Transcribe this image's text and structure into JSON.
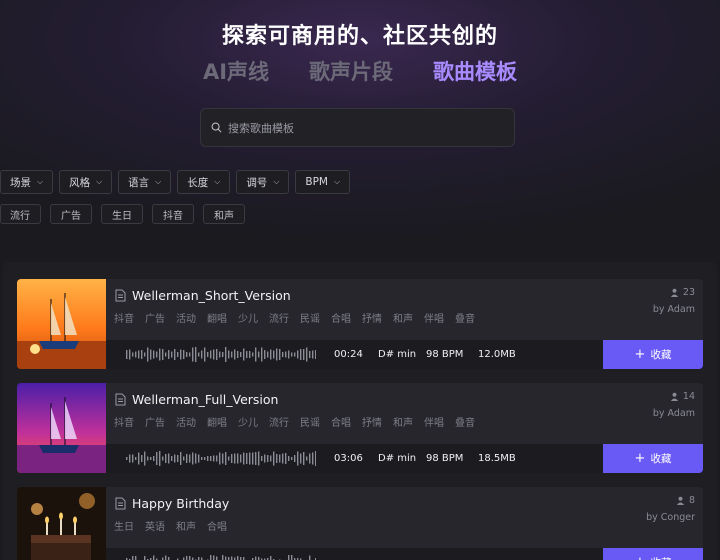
{
  "hero": {
    "title": "探索可商用的、社区共创的",
    "tabs": [
      {
        "label": "AI声线",
        "active": false
      },
      {
        "label": "歌声片段",
        "active": false
      },
      {
        "label": "歌曲模板",
        "active": true
      }
    ]
  },
  "search": {
    "placeholder": "搜索歌曲模板",
    "icon": "search-icon"
  },
  "filters": [
    "场景",
    "风格",
    "语言",
    "长度",
    "调号",
    "BPM"
  ],
  "quick_tags": [
    "流行",
    "广告",
    "生日",
    "抖音",
    "和声"
  ],
  "songs": [
    {
      "title": "Wellerman_Short_Version",
      "tags": [
        "抖音",
        "广告",
        "活动",
        "翻唱",
        "少儿",
        "流行",
        "民谣",
        "合唱",
        "抒情",
        "和声",
        "伴唱",
        "叠音"
      ],
      "count": "23",
      "author": "by Adam",
      "duration": "00:24",
      "key": "D# min",
      "bpm": "98 BPM",
      "size": "12.0MB",
      "fav_label": "收藏",
      "thumb": "sunset-ship"
    },
    {
      "title": "Wellerman_Full_Version",
      "tags": [
        "抖音",
        "广告",
        "活动",
        "翻唱",
        "少儿",
        "流行",
        "民谣",
        "合唱",
        "抒情",
        "和声",
        "伴唱",
        "叠音"
      ],
      "count": "14",
      "author": "by Adam",
      "duration": "03:06",
      "key": "D# min",
      "bpm": "98 BPM",
      "size": "18.5MB",
      "fav_label": "收藏",
      "thumb": "purple-ship"
    },
    {
      "title": "Happy Birthday",
      "tags": [
        "生日",
        "英语",
        "和声",
        "合唱"
      ],
      "count": "8",
      "author": "by Conger",
      "duration": "",
      "key": "",
      "bpm": "",
      "size": "",
      "fav_label": "收藏",
      "thumb": "birthday-cake"
    }
  ],
  "colors": {
    "accent": "#6a5af5",
    "active_tab": "#a98bff",
    "background": "#1a1a1f"
  }
}
